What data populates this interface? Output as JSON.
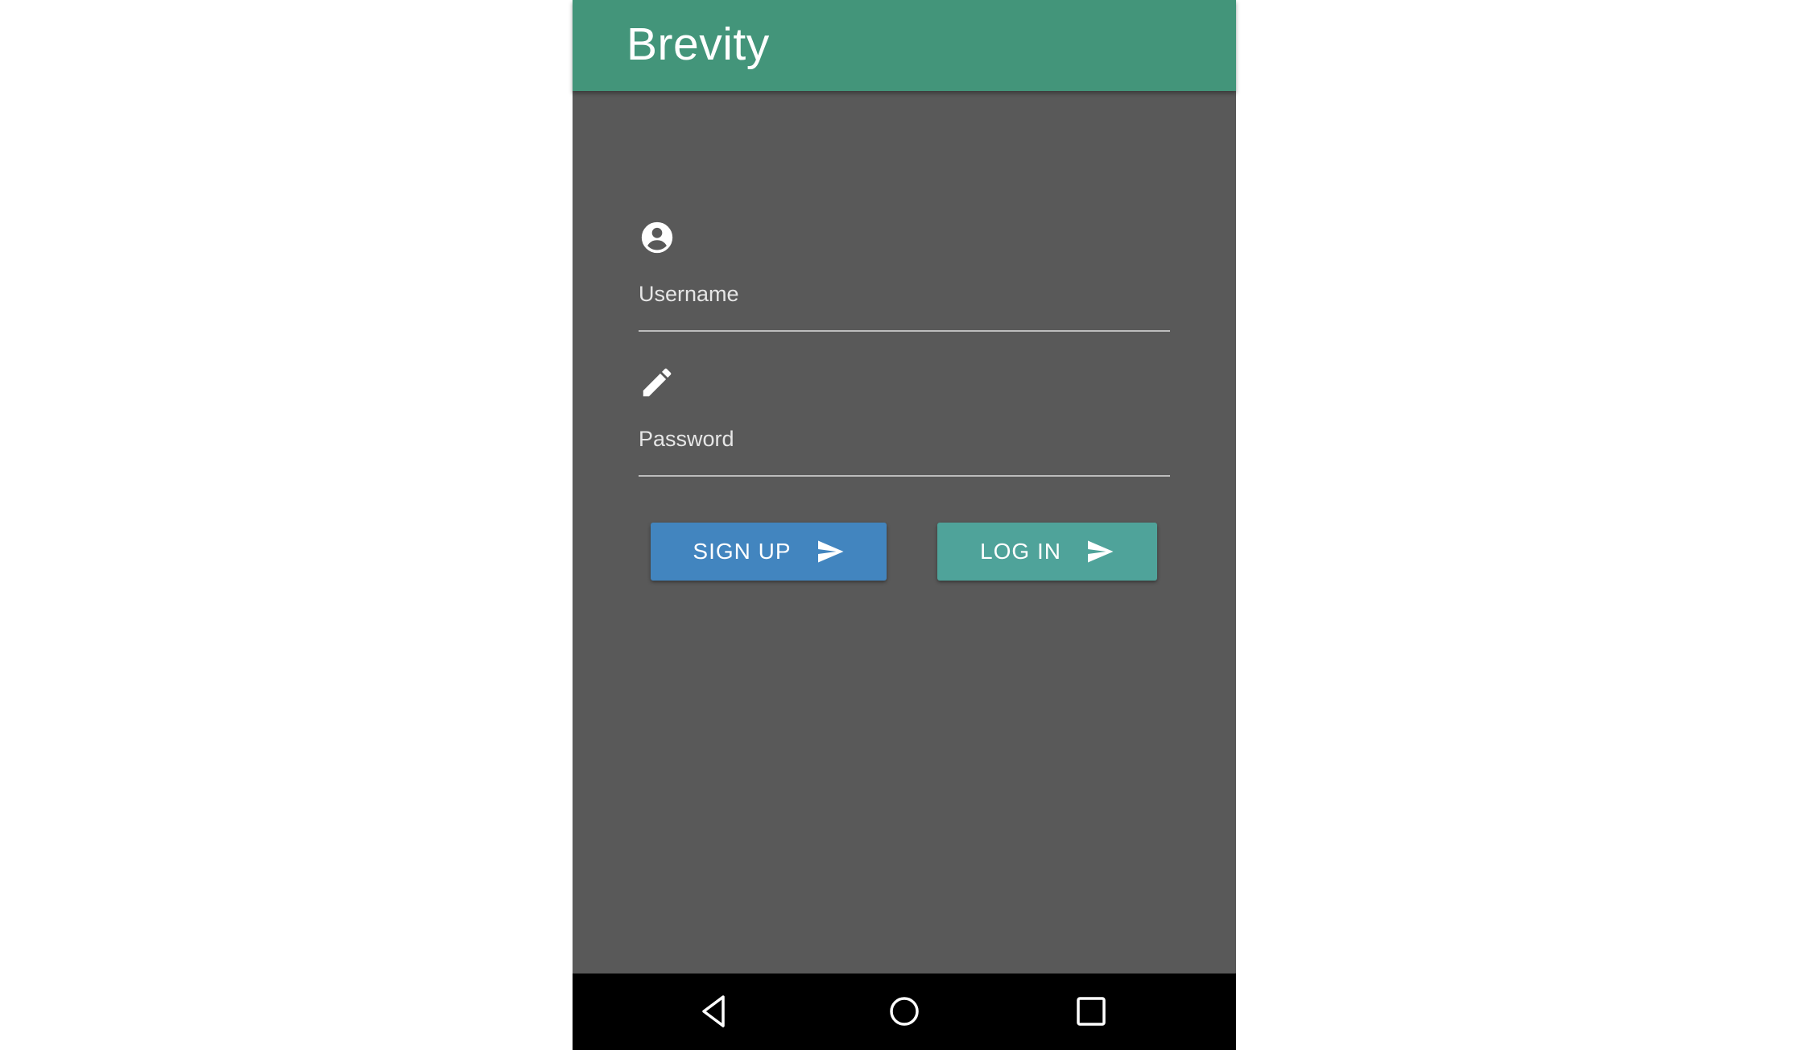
{
  "appbar": {
    "title": "Brevity",
    "color": "#43957a"
  },
  "form": {
    "username": {
      "label": "Username",
      "icon": "account-circle-icon",
      "value": ""
    },
    "password": {
      "label": "Password",
      "icon": "pencil-icon",
      "value": ""
    }
  },
  "buttons": {
    "signup": {
      "label": "SIGN UP",
      "icon": "send-icon",
      "color": "#4285bf"
    },
    "login": {
      "label": "LOG IN",
      "icon": "send-icon",
      "color": "#4fa39a"
    }
  },
  "navbar": {
    "back_icon": "back-triangle-icon",
    "home_icon": "home-circle-icon",
    "recents_icon": "recents-square-icon"
  },
  "colors": {
    "background": "#595959",
    "text": "#ffffff"
  }
}
